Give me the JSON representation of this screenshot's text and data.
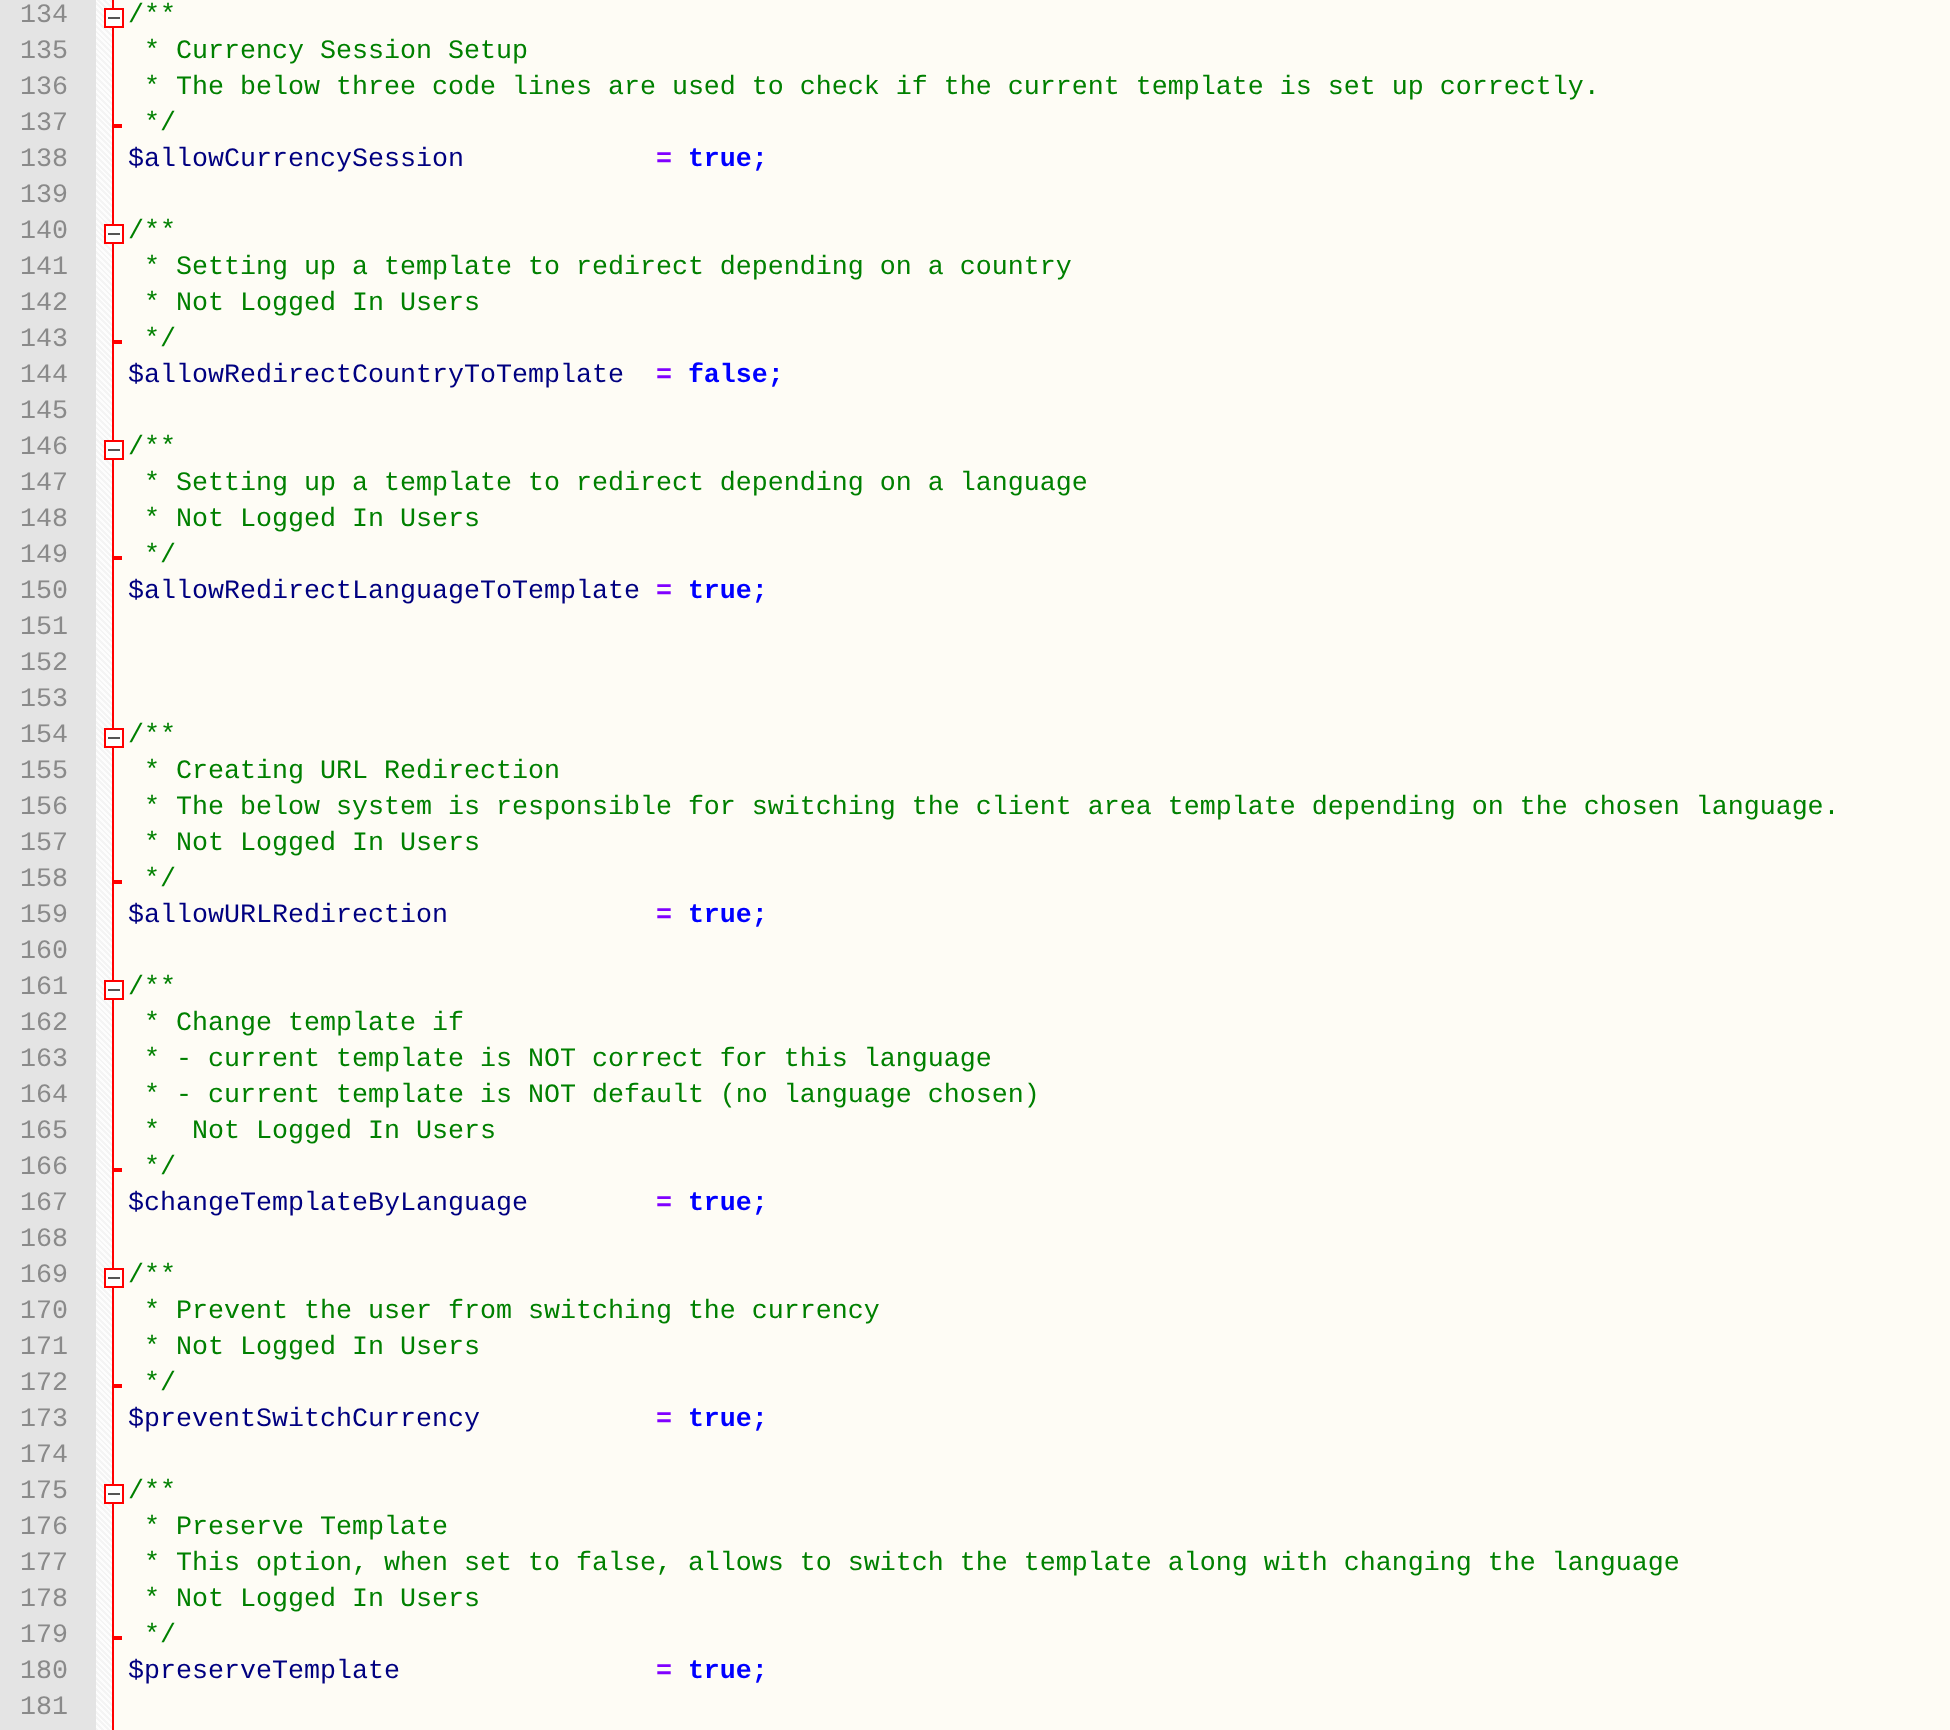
{
  "lines": [
    {
      "number": "134",
      "kind": "comment_start",
      "text": "/**",
      "expanded": true
    },
    {
      "number": "135",
      "kind": "comment",
      "text": "* Currency Session Setup"
    },
    {
      "number": "136",
      "kind": "comment",
      "text": "* The below three code lines are used to check if the current template is set up correctly."
    },
    {
      "number": "137",
      "kind": "comment_end",
      "text": "*/"
    },
    {
      "number": "138",
      "kind": "code",
      "variable": "$allowCurrencySession",
      "operator": "=",
      "value": "true;"
    },
    {
      "number": "139",
      "kind": "blank"
    },
    {
      "number": "140",
      "kind": "comment_start",
      "text": "/**",
      "expanded": true
    },
    {
      "number": "141",
      "kind": "comment",
      "text": "* Setting up a template to redirect depending on a country"
    },
    {
      "number": "142",
      "kind": "comment",
      "text": "* Not Logged In Users"
    },
    {
      "number": "143",
      "kind": "comment_end",
      "text": "*/"
    },
    {
      "number": "144",
      "kind": "code",
      "variable": "$allowRedirectCountryToTemplate",
      "operator": "=",
      "value": "false;"
    },
    {
      "number": "145",
      "kind": "blank"
    },
    {
      "number": "146",
      "kind": "comment_start",
      "text": "/**",
      "expanded": true
    },
    {
      "number": "147",
      "kind": "comment",
      "text": "* Setting up a template to redirect depending on a language"
    },
    {
      "number": "148",
      "kind": "comment",
      "text": "* Not Logged In Users"
    },
    {
      "number": "149",
      "kind": "comment_end",
      "text": "*/"
    },
    {
      "number": "150",
      "kind": "code",
      "variable": "$allowRedirectLanguageToTemplate",
      "operator": "=",
      "value": "true;"
    },
    {
      "number": "151",
      "kind": "blank"
    },
    {
      "number": "152",
      "kind": "blank"
    },
    {
      "number": "153",
      "kind": "blank"
    },
    {
      "number": "154",
      "kind": "comment_start",
      "text": "/**",
      "expanded": true
    },
    {
      "number": "155",
      "kind": "comment",
      "text": "* Creating URL Redirection"
    },
    {
      "number": "156",
      "kind": "comment",
      "text": "* The below system is responsible for switching the client area template depending on the chosen language."
    },
    {
      "number": "157",
      "kind": "comment",
      "text": "* Not Logged In Users"
    },
    {
      "number": "158",
      "kind": "comment_end",
      "text": "*/"
    },
    {
      "number": "159",
      "kind": "code",
      "variable": "$allowURLRedirection",
      "operator": "=",
      "value": "true;"
    },
    {
      "number": "160",
      "kind": "blank"
    },
    {
      "number": "161",
      "kind": "comment_start",
      "text": "/**",
      "expanded": true
    },
    {
      "number": "162",
      "kind": "comment",
      "text": "* Change template if"
    },
    {
      "number": "163",
      "kind": "comment",
      "text": "* - current template is NOT correct for this language"
    },
    {
      "number": "164",
      "kind": "comment",
      "text": "* - current template is NOT default (no language chosen)"
    },
    {
      "number": "165",
      "kind": "comment",
      "text": "*  Not Logged In Users"
    },
    {
      "number": "166",
      "kind": "comment_end",
      "text": "*/"
    },
    {
      "number": "167",
      "kind": "code",
      "variable": "$changeTemplateByLanguage",
      "operator": "=",
      "value": "true;"
    },
    {
      "number": "168",
      "kind": "blank"
    },
    {
      "number": "169",
      "kind": "comment_start",
      "text": "/**",
      "expanded": true
    },
    {
      "number": "170",
      "kind": "comment",
      "text": "* Prevent the user from switching the currency"
    },
    {
      "number": "171",
      "kind": "comment",
      "text": "* Not Logged In Users"
    },
    {
      "number": "172",
      "kind": "comment_end",
      "text": "*/"
    },
    {
      "number": "173",
      "kind": "code",
      "variable": "$preventSwitchCurrency",
      "operator": "=",
      "value": "true;"
    },
    {
      "number": "174",
      "kind": "blank"
    },
    {
      "number": "175",
      "kind": "comment_start",
      "text": "/**",
      "expanded": true
    },
    {
      "number": "176",
      "kind": "comment",
      "text": "* Preserve Template"
    },
    {
      "number": "177",
      "kind": "comment",
      "text": "* This option, when set to false, allows to switch the template along with changing the language"
    },
    {
      "number": "178",
      "kind": "comment",
      "text": "* Not Logged In Users"
    },
    {
      "number": "179",
      "kind": "comment_end",
      "text": "*/"
    },
    {
      "number": "180",
      "kind": "code",
      "variable": "$preserveTemplate",
      "operator": "=",
      "value": "true;"
    },
    {
      "number": "181",
      "kind": "blank"
    }
  ]
}
